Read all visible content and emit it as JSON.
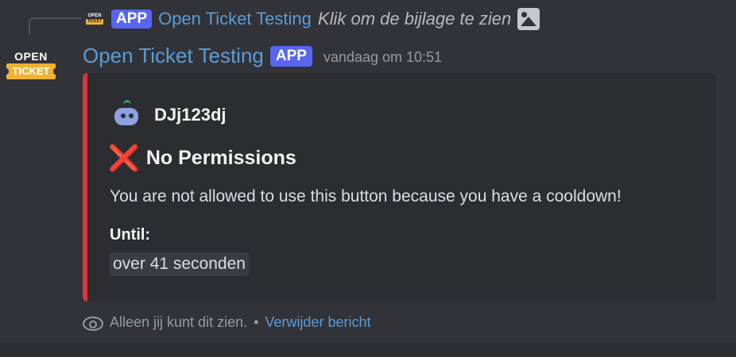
{
  "reply": {
    "badge": "APP",
    "author": "Open Ticket Testing",
    "text": "Klik om de bijlage te zien",
    "logo_text_top": "OPEN",
    "logo_text_bottom": "TICKET",
    "attachment_icon": "image-icon"
  },
  "avatar": {
    "line1": "OPEN",
    "line2": "TICKET"
  },
  "message": {
    "author": "Open Ticket Testing",
    "badge": "APP",
    "timestamp": "vandaag om 10:51"
  },
  "embed": {
    "accent_color": "#da373c",
    "author_name": "DJj123dj",
    "title_icon": "cross-mark-icon",
    "title_icon_glyph": "❌",
    "title": "No Permissions",
    "description": "You are not allowed to use this button because you have a cooldown!",
    "field_name": "Until:",
    "field_value": "over 41 seconden"
  },
  "ephemeral": {
    "text": "Alleen jij kunt dit zien.",
    "separator": "•",
    "delete_label": "Verwijder bericht"
  }
}
